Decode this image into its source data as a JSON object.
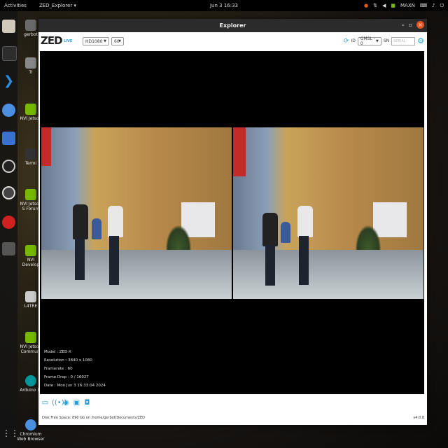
{
  "topbar": {
    "activities": "Activities",
    "app_menu": "ZED_Explorer",
    "clock": "Jun 3  16:33",
    "user": "MAXN"
  },
  "desktop": {
    "icons": [
      {
        "label": "gerbot",
        "icon": "home-folder-icon"
      },
      {
        "label": "Tr",
        "icon": "trash-icon"
      },
      {
        "label": "NVI Jetson",
        "icon": "nvidia-icon"
      },
      {
        "label": "Termi",
        "icon": "terminal-icon"
      },
      {
        "label": "NVI Jetson S Forum",
        "icon": "nvidia-icon"
      },
      {
        "label": "NVI Develop",
        "icon": "nvidia-icon"
      },
      {
        "label": "L4TRE",
        "icon": "document-icon"
      },
      {
        "label": "NVI Jetson Communi",
        "icon": "nvidia-icon"
      },
      {
        "label": "Arduino ID",
        "icon": "arduino-icon"
      },
      {
        "label": "Chromium Web Browser",
        "icon": "chromium-icon"
      }
    ]
  },
  "window": {
    "title": "Explorer",
    "logo": "ZED",
    "live": "LIVE",
    "resolution_select": "HD1080",
    "fps_select": "60",
    "id_label": "ID",
    "id_select": "GMSL - 0",
    "sn_label": "SN",
    "sn_placeholder": "SERIAL"
  },
  "info": {
    "model": "Model : ZED-X",
    "resolution": "Resolution : 3840 x 1080",
    "framerate": "Framerate : 60",
    "frame_drop": "Frame Drop : 0 / 16027",
    "date": "Date : Mon Jun 3 16:33:04 2024"
  },
  "status": {
    "disk": "Disk Free Space: 890 Gb  on /home/gerbot/Documents/ZED",
    "version": "v4.0.8"
  },
  "colors": {
    "accent": "#2a9fd6",
    "close": "#e95420",
    "titlebar": "#2b2b2b"
  }
}
